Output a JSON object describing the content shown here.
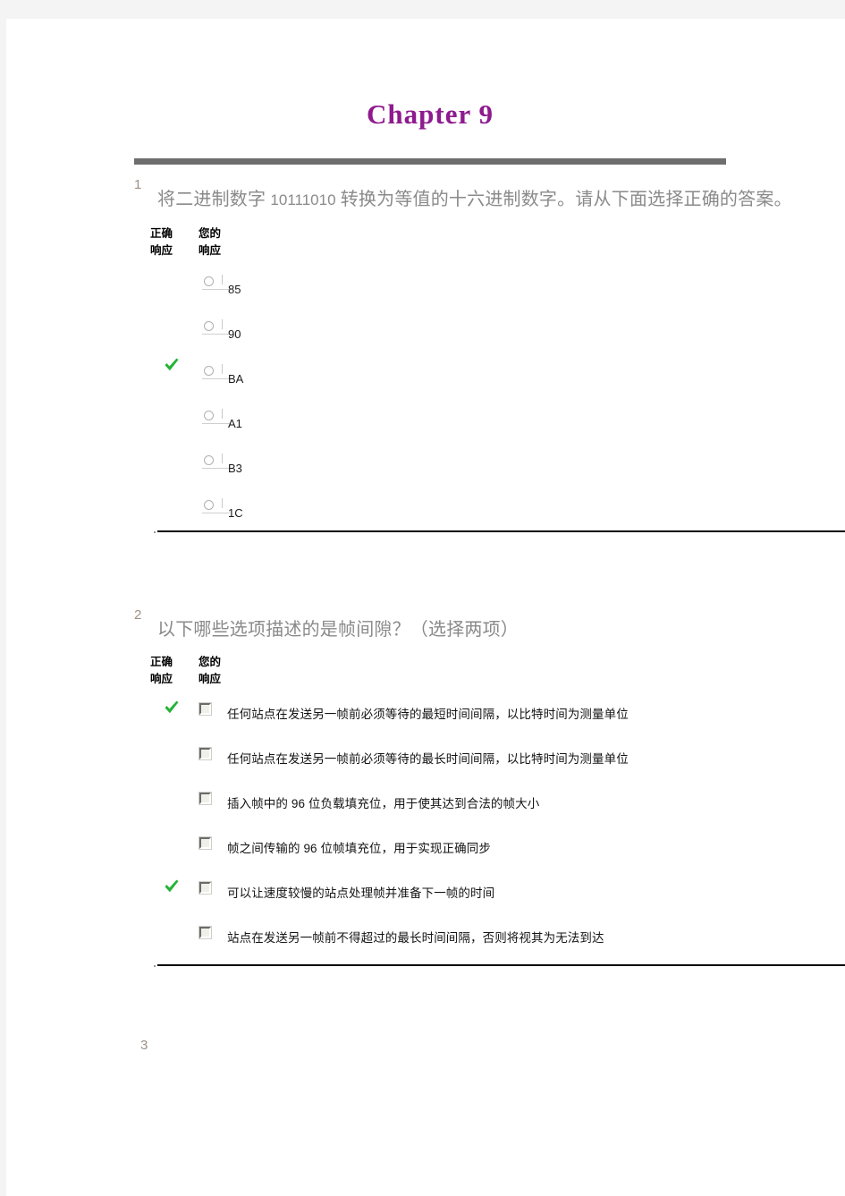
{
  "document": {
    "title": "Chapter  9",
    "title_color": "#8e1a8e"
  },
  "questions": [
    {
      "number": "1",
      "text_prefix": "将二进制数字 ",
      "text_code": "10111010",
      "text_suffix": " 转换为等值的十六进制数字。请从下面选择正确的答案。",
      "full_text": "将二进制数字 10111010 转换为等值的十六进制数字。请从下面选择正确的答案。",
      "headers": {
        "correct": "正确\n响应",
        "yours": "您的\n响应"
      },
      "input_type": "radio",
      "options": [
        {
          "label": "85",
          "correct": false,
          "selected": false
        },
        {
          "label": "90",
          "correct": false,
          "selected": false
        },
        {
          "label": "BA",
          "correct": true,
          "selected": false
        },
        {
          "label": "A1",
          "correct": false,
          "selected": false
        },
        {
          "label": "B3",
          "correct": false,
          "selected": false
        },
        {
          "label": "1C",
          "correct": false,
          "selected": false
        }
      ]
    },
    {
      "number": "2",
      "full_text": "以下哪些选项描述的是帧间隙？（选择两项）",
      "headers": {
        "correct": "正确\n响应",
        "yours": "您的\n响应"
      },
      "input_type": "checkbox",
      "options": [
        {
          "label": "任何站点在发送另一帧前必须等待的最短时间间隔，以比特时间为测量单位",
          "correct": true,
          "selected": false
        },
        {
          "label": "任何站点在发送另一帧前必须等待的最长时间间隔，以比特时间为测量单位",
          "correct": false,
          "selected": false
        },
        {
          "label": "插入帧中的 96 位负载填充位，用于使其达到合法的帧大小",
          "correct": false,
          "selected": false
        },
        {
          "label": "帧之间传输的 96 位帧填充位，用于实现正确同步",
          "correct": false,
          "selected": false
        },
        {
          "label": "可以让速度较慢的站点处理帧并准备下一帧的时间",
          "correct": true,
          "selected": false
        },
        {
          "label": "站点在发送另一帧前不得超过的最长时间间隔，否则将视其为无法到达",
          "correct": false,
          "selected": false
        }
      ]
    },
    {
      "number": "3",
      "full_text": ""
    }
  ],
  "colors": {
    "check_green": "#25b336",
    "rule_gray": "#6e6e6e",
    "question_text": "#8a8a8a",
    "question_number": "#9c9186"
  }
}
